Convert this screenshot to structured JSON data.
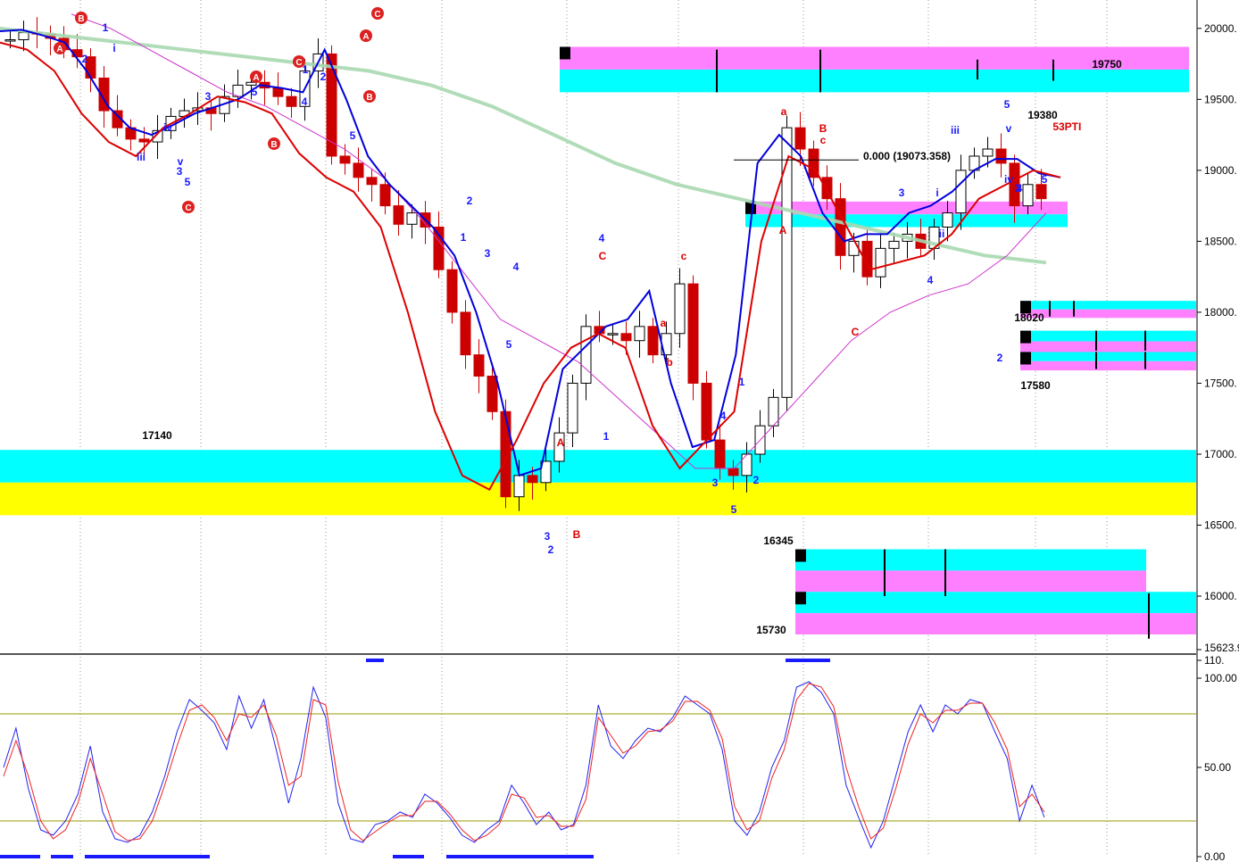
{
  "chart_data": [
    {
      "type": "candlestick",
      "title": "",
      "xlabel": "",
      "ylabel": "",
      "ylim": [
        15623,
        20200
      ],
      "y_ticks": [
        "20000.",
        "19500.",
        "19000.",
        "18500.",
        "18000.",
        "17500.",
        "17000.",
        "16500.",
        "16000.",
        "15623.9"
      ],
      "y_tick_values": [
        20000,
        19500,
        19000,
        18500,
        18000,
        17500,
        17000,
        16500,
        16000,
        15623
      ],
      "grid": "vertical dotted",
      "closes": [
        19920,
        19970,
        19960,
        19930,
        19850,
        19800,
        19650,
        19420,
        19300,
        19220,
        19200,
        19280,
        19380,
        19420,
        19440,
        19400,
        19520,
        19600,
        19620,
        19580,
        19520,
        19450,
        19700,
        19820,
        19100,
        19050,
        18950,
        18900,
        18750,
        18620,
        18700,
        18600,
        18300,
        18000,
        17700,
        17550,
        17300,
        16700,
        16850,
        16800,
        16950,
        17150,
        17500,
        17900,
        17850,
        17850,
        17800,
        17900,
        17700,
        17850,
        18200,
        17500,
        17100,
        16900,
        16850,
        17000,
        17200,
        17400,
        19300,
        19150,
        18950,
        18800,
        18400,
        18500,
        18250,
        18450,
        18500,
        18550,
        18450,
        18600,
        18700,
        19000,
        19100,
        19150,
        19050,
        18750,
        18900,
        18800
      ],
      "ma_blue": [
        19980,
        19990,
        19950,
        19900,
        19700,
        19450,
        19300,
        19250,
        19320,
        19400,
        19450,
        19500,
        19600,
        19580,
        19550,
        19850,
        19500,
        19100,
        18900,
        18750,
        18600,
        18400,
        18000,
        17500,
        16850,
        16900,
        17600,
        17750,
        17900,
        17950,
        18150,
        17500,
        17050,
        17100,
        17700,
        19050,
        19250,
        19100,
        18700,
        18500,
        18550,
        18550,
        18700,
        18750,
        18850,
        19000,
        19080,
        19080,
        18980,
        18950
      ],
      "ma_red": [
        19900,
        19850,
        19700,
        19400,
        19200,
        19100,
        19300,
        19400,
        19520,
        19480,
        19400,
        19120,
        18950,
        18850,
        18600,
        18000,
        17300,
        16850,
        16750,
        17100,
        17500,
        17750,
        17850,
        17750,
        17200,
        16900,
        17100,
        17300,
        18500,
        19100,
        19000,
        18650,
        18300,
        18350,
        18400,
        18550,
        18800,
        18900,
        19000,
        18950
      ],
      "ma_magenta": [
        20100,
        20000,
        19850,
        19700,
        19550,
        19450,
        19300,
        19150,
        18950,
        18650,
        18300,
        17950,
        17800,
        17650,
        17400,
        17150,
        16900,
        16900,
        17200,
        17500,
        17800,
        18000,
        18120,
        18200,
        18400,
        18700
      ],
      "ma_green": [
        20000,
        19950,
        19900,
        19850,
        19800,
        19750,
        19700,
        19600,
        19450,
        19250,
        19050,
        18900,
        18800,
        18700,
        18600,
        18500,
        18400,
        18350
      ],
      "annotations": [
        {
          "text": "19750",
          "value": 19750
        },
        {
          "text": "19380",
          "value": 19380
        },
        {
          "text": "18020",
          "value": 18020
        },
        {
          "text": "17580",
          "value": 17580
        },
        {
          "text": "17140",
          "value": 17140
        },
        {
          "text": "16345",
          "value": 16345
        },
        {
          "text": "15730",
          "value": 15730
        },
        {
          "text": "0.000 (19073.358)",
          "value": 19073
        },
        {
          "text": "53",
          "value": 19330
        },
        {
          "text": "PTI",
          "value": 19330
        }
      ],
      "wave_labels_blue": [
        "1",
        "2",
        "i",
        "iii",
        "iv",
        "v",
        "3",
        "5",
        "3",
        "5",
        "1",
        "2",
        "3",
        "4",
        "5",
        "3",
        "5",
        "4",
        "1",
        "2",
        "3",
        "4",
        "5",
        "1",
        "2",
        "3",
        "4",
        "5",
        "i",
        "ii",
        "iii",
        "v",
        "iv",
        "3",
        "4",
        "5",
        "2",
        "1",
        "2",
        "4"
      ],
      "wave_labels_red": [
        "A",
        "B",
        "C",
        "A",
        "B",
        "C",
        "A",
        "B",
        "C",
        "a",
        "b",
        "c",
        "A",
        "B",
        "C",
        "a",
        "B",
        "c",
        "A",
        "C"
      ],
      "zones": [
        {
          "name": "cyan-zone-lower",
          "from": 16800,
          "to": 17030,
          "color": "#00ffff"
        },
        {
          "name": "yellow-zone-lower",
          "from": 16570,
          "to": 16800,
          "color": "#ffff00"
        },
        {
          "name": "top-zone",
          "from": 19550,
          "to": 19870,
          "colors": [
            "#ff80ff",
            "#00ffff"
          ]
        },
        {
          "name": "mid-zone",
          "from": 18600,
          "to": 18780,
          "colors": [
            "#ff80ff",
            "#00ffff"
          ]
        },
        {
          "name": "target-18020",
          "from": 17960,
          "to": 18080,
          "colors": [
            "#00ffff",
            "#ff80ff"
          ]
        },
        {
          "name": "target-17900",
          "from": 17720,
          "to": 17870,
          "colors": [
            "#00ffff",
            "#ff80ff"
          ]
        },
        {
          "name": "target-17580",
          "from": 17590,
          "to": 17720,
          "colors": [
            "#00ffff",
            "#ff80ff"
          ]
        },
        {
          "name": "target-16345",
          "from": 16030,
          "to": 16330,
          "colors": [
            "#00ffff",
            "#ff80ff"
          ]
        },
        {
          "name": "target-15730",
          "from": 15730,
          "to": 16030,
          "colors": [
            "#00ffff",
            "#ff80ff"
          ]
        }
      ],
      "colors": {
        "ma_blue": "#0000dd",
        "ma_red": "#dd0000",
        "ma_magenta": "#cc33cc",
        "ma_green": "#a8d8b0",
        "cyan": "#00ffff",
        "magenta": "#ff80ff",
        "yellow": "#ffff00"
      }
    },
    {
      "type": "line",
      "title": "",
      "ylim": [
        0,
        110
      ],
      "y_ticks": [
        "110.",
        "100.00",
        "50.00",
        "0.00"
      ],
      "y_tick_values": [
        110,
        100,
        50,
        0
      ],
      "reference_lines": [
        80,
        20
      ],
      "series": [
        {
          "color": "#2222ee",
          "values": [
            50,
            72,
            38,
            15,
            12,
            20,
            35,
            62,
            25,
            10,
            8,
            12,
            25,
            45,
            70,
            88,
            82,
            75,
            60,
            90,
            72,
            88,
            60,
            30,
            55,
            95,
            78,
            30,
            10,
            8,
            18,
            20,
            25,
            22,
            35,
            30,
            22,
            12,
            8,
            15,
            20,
            40,
            30,
            18,
            25,
            15,
            18,
            40,
            85,
            62,
            55,
            65,
            72,
            70,
            78,
            90,
            85,
            80,
            60,
            20,
            12,
            25,
            50,
            65,
            95,
            98,
            92,
            80,
            40,
            22,
            5,
            20,
            45,
            70,
            85,
            70,
            85,
            80,
            88,
            86,
            70,
            55,
            20,
            40,
            22
          ]
        },
        {
          "color": "#ee2222",
          "values": [
            45,
            65,
            45,
            20,
            10,
            15,
            30,
            55,
            35,
            14,
            9,
            10,
            20,
            40,
            62,
            82,
            85,
            78,
            65,
            80,
            78,
            85,
            68,
            40,
            45,
            88,
            85,
            42,
            15,
            9,
            14,
            19,
            23,
            23,
            31,
            31,
            24,
            15,
            9,
            12,
            18,
            35,
            33,
            22,
            23,
            17,
            17,
            32,
            78,
            68,
            58,
            62,
            70,
            71,
            76,
            87,
            87,
            82,
            66,
            28,
            15,
            20,
            44,
            60,
            88,
            97,
            95,
            84,
            50,
            28,
            10,
            16,
            38,
            63,
            80,
            75,
            82,
            82,
            86,
            86,
            75,
            60,
            28,
            35,
            25
          ]
        }
      ]
    }
  ]
}
